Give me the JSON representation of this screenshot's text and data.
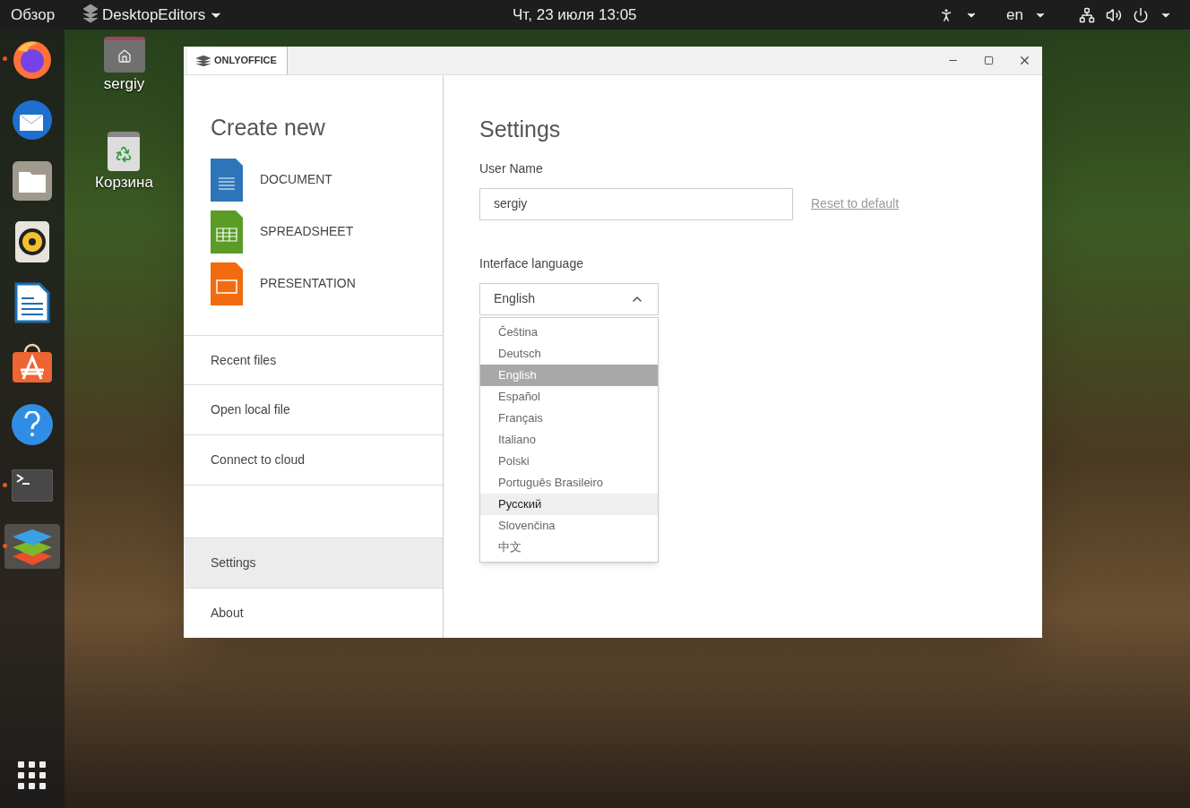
{
  "top_bar": {
    "overview": "Обзор",
    "app_menu": "DesktopEditors",
    "clock": "Чт, 23 июля  13:05",
    "keyboard_layout": "en"
  },
  "dock": {
    "items": [
      {
        "kind": "firefox",
        "running": true,
        "selected": false
      },
      {
        "kind": "mail",
        "running": false,
        "selected": false
      },
      {
        "kind": "files",
        "running": false,
        "selected": false
      },
      {
        "kind": "music",
        "running": false,
        "selected": false
      },
      {
        "kind": "writer",
        "running": false,
        "selected": false
      },
      {
        "kind": "store",
        "running": false,
        "selected": false
      },
      {
        "kind": "help",
        "running": false,
        "selected": false
      },
      {
        "kind": "terminal",
        "running": true,
        "selected": false
      },
      {
        "kind": "onlyoffice",
        "running": true,
        "selected": true
      }
    ]
  },
  "desktop_icons": [
    {
      "kind": "home",
      "label": "sergiy"
    },
    {
      "kind": "trash",
      "label": "Корзина"
    }
  ],
  "window": {
    "tab": "ONLYOFFICE",
    "sidebar": {
      "create_title": "Create new",
      "create_items": [
        {
          "kind": "document",
          "label": "DOCUMENT"
        },
        {
          "kind": "spreadsheet",
          "label": "SPREADSHEET"
        },
        {
          "kind": "presentation",
          "label": "PRESENTATION"
        }
      ],
      "nav_items": [
        {
          "label": "Recent files",
          "selected": false
        },
        {
          "label": "Open local file",
          "selected": false
        },
        {
          "label": "Connect to cloud",
          "selected": false
        }
      ],
      "bottom_items": [
        {
          "label": "Settings",
          "selected": true
        },
        {
          "label": "About",
          "selected": false
        }
      ]
    },
    "settings": {
      "title": "Settings",
      "user_name_label": "User Name",
      "user_name_value": "sergiy",
      "reset_link": "Reset to default",
      "language_label": "Interface language",
      "language_value": "English",
      "expanded": true,
      "languages": [
        {
          "label": "Čeština",
          "selected": false,
          "hovered": false
        },
        {
          "label": "Deutsch",
          "selected": false,
          "hovered": false
        },
        {
          "label": "English",
          "selected": true,
          "hovered": false
        },
        {
          "label": "Español",
          "selected": false,
          "hovered": false
        },
        {
          "label": "Français",
          "selected": false,
          "hovered": false
        },
        {
          "label": "Italiano",
          "selected": false,
          "hovered": false
        },
        {
          "label": "Polski",
          "selected": false,
          "hovered": false
        },
        {
          "label": "Português Brasileiro",
          "selected": false,
          "hovered": false
        },
        {
          "label": "Русский",
          "selected": false,
          "hovered": true
        },
        {
          "label": "Slovenčina",
          "selected": false,
          "hovered": false
        },
        {
          "label": "中文",
          "selected": false,
          "hovered": false
        }
      ]
    }
  }
}
